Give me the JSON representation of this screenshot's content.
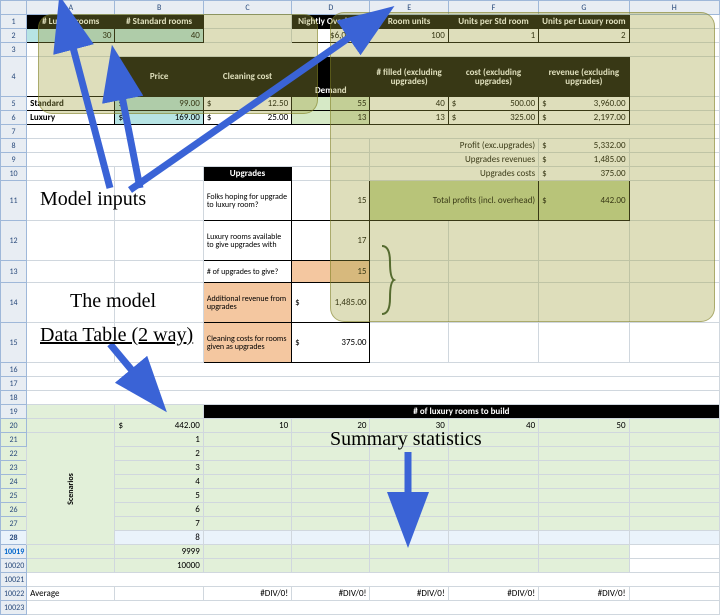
{
  "columns": [
    "",
    "A",
    "B",
    "C",
    "D",
    "E",
    "F",
    "G",
    "H"
  ],
  "rows_main": [
    "1",
    "2",
    "3",
    "4",
    "5",
    "6",
    "7",
    "8",
    "9",
    "10",
    "11",
    "12",
    "13",
    "14",
    "15",
    "16",
    "17",
    "18",
    "19",
    "20",
    "21",
    "22",
    "23",
    "24",
    "25",
    "26",
    "27",
    "28",
    "10019",
    "10020",
    "10021",
    "10022",
    "10023"
  ],
  "header_row1": {
    "a": "# Luxury rooms",
    "b": "# Standard rooms",
    "d": "Nightly Overhead",
    "e": "Room units",
    "f": "Units per Std room",
    "g": "Units per Luxury room"
  },
  "row2": {
    "a": "30",
    "b": "40",
    "d": "$6,000.00",
    "e": "100",
    "f": "1",
    "g": "2"
  },
  "row4_hdrs": {
    "b": "Price",
    "c": "Cleaning cost",
    "d": "Demand",
    "e": "# filled (excluding upgrades)",
    "f": "cost (excluding upgrades)",
    "g": "revenue (excluding upgrades)"
  },
  "row5": {
    "a": "Standard",
    "b_s": "$",
    "b": "99.00",
    "c_s": "$",
    "c": "12.50",
    "d": "55",
    "e": "40",
    "f_s": "$",
    "f": "500.00",
    "g_s": "$",
    "g": "3,960.00"
  },
  "row6": {
    "a": "Luxury",
    "b_s": "$",
    "b": "169.00",
    "c_s": "$",
    "c": "25.00",
    "d": "13",
    "e": "13",
    "f_s": "$",
    "f": "325.00",
    "g_s": "$",
    "g": "2,197.00"
  },
  "row8": {
    "lbl": "Profit (exc.upgrades)",
    "s": "$",
    "v": "5,332.00"
  },
  "row9": {
    "lbl": "Upgrades revenues",
    "s": "$",
    "v": "1,485.00"
  },
  "row10": {
    "lbl": "Upgrades costs",
    "s": "$",
    "v": "375.00"
  },
  "row11": {
    "c_hdr": "Upgrades",
    "c_txt": "Folks hoping for upgrade to luxury room?",
    "d": "15",
    "lbl": "Total profits (incl. overhead)",
    "s": "$",
    "v": "442.00"
  },
  "row12": {
    "c_txt": "Luxury rooms available to give upgrades with",
    "d": "17"
  },
  "row13": {
    "c_txt": "# of upgrades to give?",
    "d": "15"
  },
  "row14": {
    "c_txt": "Additional revenue from upgrades",
    "d_s": "$",
    "d": "1,485.00"
  },
  "row15": {
    "c_txt": "Cleaning costs for rooms given as upgrades",
    "d_s": "$",
    "d": "375.00"
  },
  "row19": {
    "hdr": "# of luxury rooms to build"
  },
  "row20": {
    "s": "$",
    "a": "442.00",
    "b": "10",
    "c": "20",
    "d": "30",
    "e": "40",
    "f": "50"
  },
  "scenario_label": "Scenarios",
  "scenarios": [
    "1",
    "2",
    "3",
    "4",
    "5",
    "6",
    "7",
    "8"
  ],
  "row10019": "9999",
  "row10020": "10000",
  "summary_row": {
    "lbl": "Average",
    "v": "#DIV/0!"
  },
  "annotations": {
    "model_inputs": "Model inputs",
    "the_model": "The model",
    "data_table": "Data Table (2 way)",
    "summary": "Summary statistics"
  }
}
